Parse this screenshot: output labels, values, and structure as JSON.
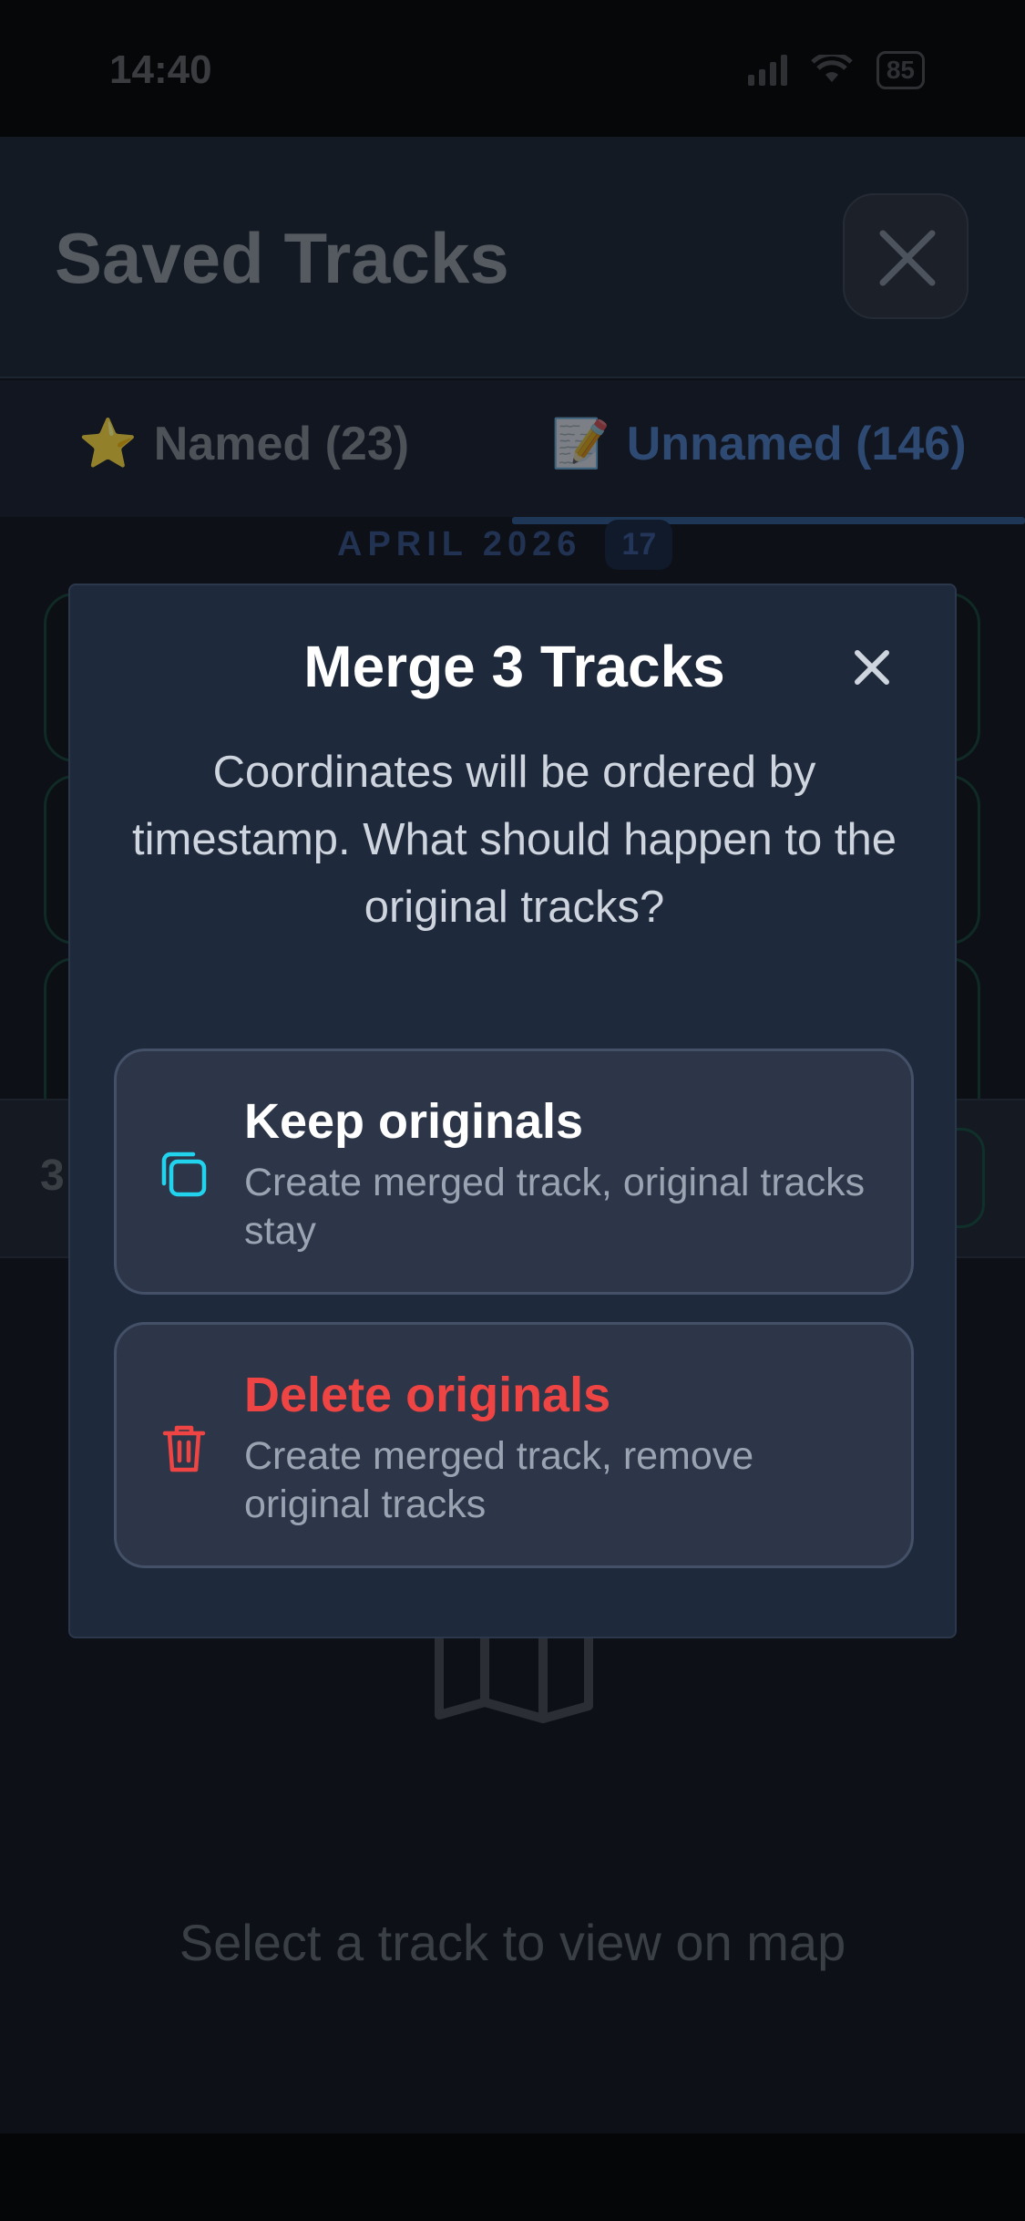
{
  "status_bar": {
    "time": "14:40",
    "battery": "85"
  },
  "sheet": {
    "title": "Saved Tracks",
    "close_icon": "close-icon"
  },
  "tabs": [
    {
      "emoji": "⭐",
      "label": "Named (23)",
      "active": false
    },
    {
      "emoji": "📝",
      "label": "Unnamed (146)",
      "active": true
    }
  ],
  "month_group": {
    "label": "APRIL 2026",
    "count": "17"
  },
  "selection_bar": {
    "count": "3"
  },
  "map_placeholder": {
    "icon": "map-icon",
    "text": "Select a track to view on map"
  },
  "modal": {
    "title": "Merge 3 Tracks",
    "close_icon": "close-icon",
    "description": "Coordinates will be ordered by timestamp. What should happen to the original tracks?",
    "options": [
      {
        "icon": "copy-icon",
        "title": "Keep originals",
        "description": "Create merged track, original tracks stay",
        "color": "#22d3ee"
      },
      {
        "icon": "trash-icon",
        "title": "Delete originals",
        "description": "Create merged track, remove original tracks",
        "color": "#ef4444"
      }
    ]
  },
  "colors": {
    "modal_bg": "#1e293b",
    "option_bg": "#2d3648",
    "accent_cyan": "#22d3ee",
    "danger_red": "#ef4444",
    "tab_active": "#3b82f6"
  }
}
